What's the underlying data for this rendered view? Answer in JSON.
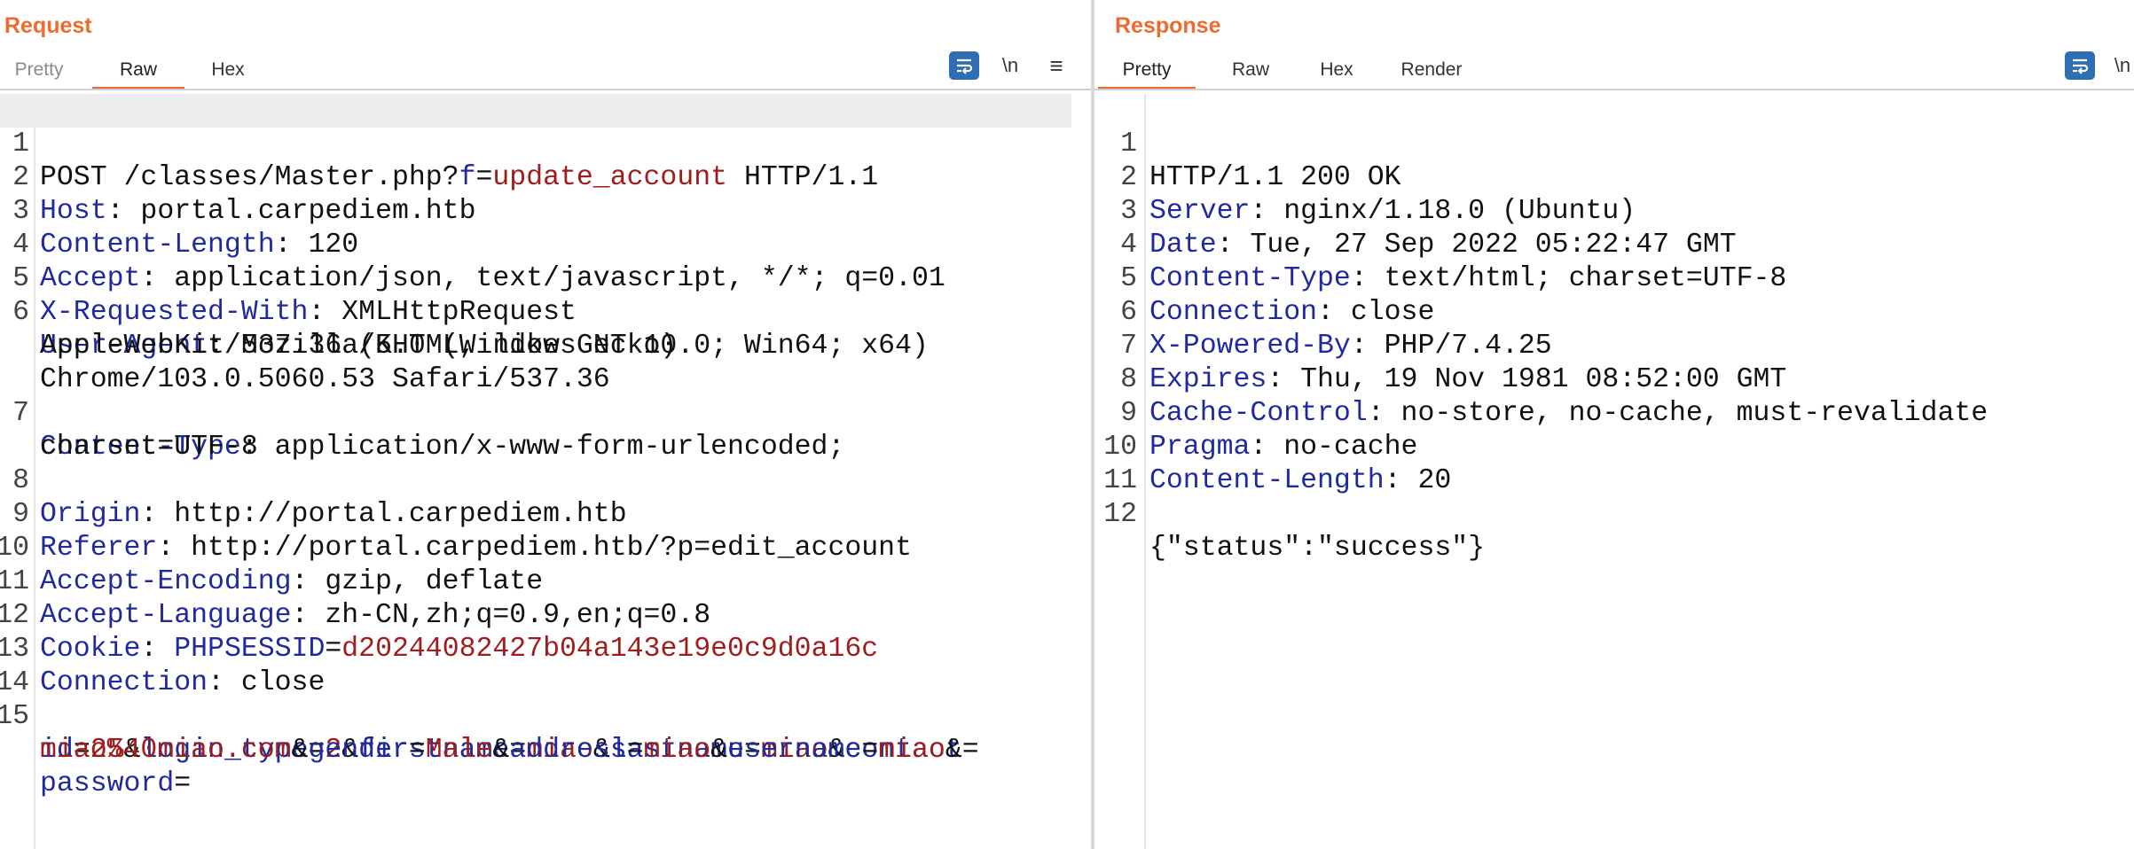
{
  "request": {
    "title": "Request",
    "tabs": [
      "Pretty",
      "Raw",
      "Hex"
    ],
    "active_tab": "Raw",
    "newline_toggle": "\\n",
    "menu_icon": "≡",
    "lines": [
      {
        "num": "1",
        "text": "POST /classes/Master.php?f=update_account HTTP/1.1"
      },
      {
        "num": "2",
        "text": "Host: portal.carpediem.htb"
      },
      {
        "num": "3",
        "text": "Content-Length: 120"
      },
      {
        "num": "4",
        "text": "Accept: application/json, text/javascript, */*; q=0.01"
      },
      {
        "num": "5",
        "text": "X-Requested-With: XMLHttpRequest"
      },
      {
        "num": "6",
        "text": "User-Agent: Mozilla/5.0 (Windows NT 10.0; Win64; x64) AppleWebKit/537.36 (KHTML, like Gecko) Chrome/103.0.5060.53 Safari/537.36"
      },
      {
        "num": "7",
        "text": "Content-Type: application/x-www-form-urlencoded; charset=UTF-8"
      },
      {
        "num": "8",
        "text": "Origin: http://portal.carpediem.htb"
      },
      {
        "num": "9",
        "text": "Referer: http://portal.carpediem.htb/?p=edit_account"
      },
      {
        "num": "10",
        "text": "Accept-Encoding: gzip, deflate"
      },
      {
        "num": "11",
        "text": "Accept-Language: zh-CN,zh;q=0.9,en;q=0.8"
      },
      {
        "num": "12",
        "text": "Cookie: PHPSESSID=d20244082427b04a143e19e0c9d0a16c"
      },
      {
        "num": "13",
        "text": "Connection: close"
      },
      {
        "num": "14",
        "text": ""
      },
      {
        "num": "15",
        "text": "id=25&login_type=2&firstname=miao&lastname=miao&contact=miao%40miao.com&gender=Male&address=miao&username=miao&password="
      }
    ]
  },
  "response": {
    "title": "Response",
    "tabs": [
      "Pretty",
      "Raw",
      "Hex",
      "Render"
    ],
    "active_tab": "Pretty",
    "newline_toggle": "\\n",
    "lines": [
      {
        "num": "1",
        "text": "HTTP/1.1 200 OK"
      },
      {
        "num": "2",
        "text": "Server: nginx/1.18.0 (Ubuntu)"
      },
      {
        "num": "3",
        "text": "Date: Tue, 27 Sep 2022 05:22:47 GMT"
      },
      {
        "num": "4",
        "text": "Content-Type: text/html; charset=UTF-8"
      },
      {
        "num": "5",
        "text": "Connection: close"
      },
      {
        "num": "6",
        "text": "X-Powered-By: PHP/7.4.25"
      },
      {
        "num": "7",
        "text": "Expires: Thu, 19 Nov 1981 08:52:00 GMT"
      },
      {
        "num": "8",
        "text": "Cache-Control: no-store, no-cache, must-revalidate"
      },
      {
        "num": "9",
        "text": "Pragma: no-cache"
      },
      {
        "num": "10",
        "text": "Content-Length: 20"
      },
      {
        "num": "11",
        "text": ""
      },
      {
        "num": "12",
        "text": "{\"status\":\"success\"}"
      }
    ]
  },
  "icons": {
    "wrap": "word-wrap-icon",
    "layout_split": "split-view-icon",
    "layout_stack": "stacked-view-icon"
  },
  "colors": {
    "accent": "#ee6b2f",
    "key": "#1e2a9e",
    "value": "#a01d1d",
    "button": "#2f6eb2"
  }
}
